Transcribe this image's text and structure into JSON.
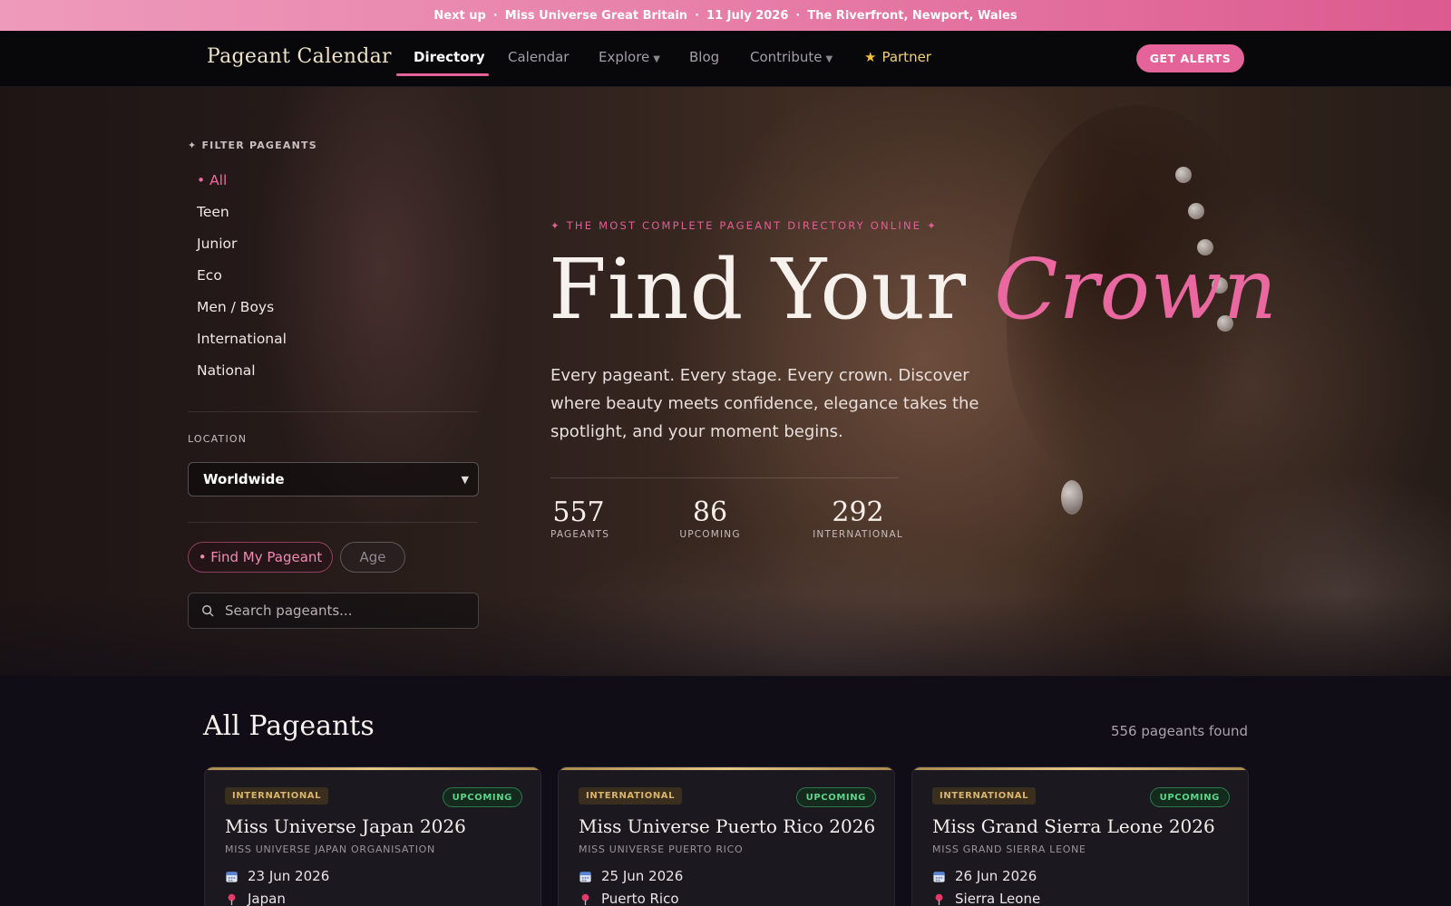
{
  "announcement": {
    "prefix": "Next up",
    "event": "Miss Universe Great Britain",
    "date": "11 July 2026",
    "venue": "The Riverfront, Newport, Wales"
  },
  "nav": {
    "brand": "Pageant Calendar",
    "links": [
      {
        "label": "Directory",
        "active": true
      },
      {
        "label": "Calendar"
      },
      {
        "label": "Explore",
        "has_dropdown": true
      },
      {
        "label": "Blog"
      },
      {
        "label": "Contribute",
        "has_dropdown": true
      },
      {
        "label": "Partner",
        "icon": "star-icon"
      }
    ],
    "cta": "GET ALERTS"
  },
  "sidebar": {
    "filter_title": "✦ FILTER PAGEANTS",
    "filters": [
      {
        "label": "• All",
        "active": true
      },
      {
        "label": "Teen"
      },
      {
        "label": "Junior"
      },
      {
        "label": "Eco"
      },
      {
        "label": "Men / Boys"
      },
      {
        "label": "International"
      },
      {
        "label": "National"
      }
    ],
    "location_label": "LOCATION",
    "location_value": "Worldwide",
    "find_label": "• Find My Pageant",
    "age_label": "Age",
    "search_placeholder": "Search pageants..."
  },
  "hero": {
    "eyebrow": "✦ THE MOST COMPLETE PAGEANT DIRECTORY ONLINE ✦",
    "headline_plain": "Find Your ",
    "headline_accent": "Crown",
    "subcopy": "Every pageant. Every stage. Every crown. Discover where beauty meets confidence, elegance takes the spotlight, and your moment begins.",
    "stats": [
      {
        "value": "557",
        "label": "PAGEANTS"
      },
      {
        "value": "86",
        "label": "UPCOMING"
      },
      {
        "value": "292",
        "label": "INTERNATIONAL"
      }
    ]
  },
  "listing": {
    "title": "All Pageants",
    "count_text": "556 pageants found",
    "cards": [
      {
        "category": "INTERNATIONAL",
        "status": "UPCOMING",
        "title": "Miss Universe Japan 2026",
        "org": "MISS UNIVERSE JAPAN ORGANISATION",
        "date": "23 Jun 2026",
        "location": "Japan"
      },
      {
        "category": "INTERNATIONAL",
        "status": "UPCOMING",
        "title": "Miss Universe Puerto Rico 2026",
        "org": "MISS UNIVERSE PUERTO RICO",
        "date": "25 Jun 2026",
        "location": "Puerto Rico"
      },
      {
        "category": "INTERNATIONAL",
        "status": "UPCOMING",
        "title": "Miss Grand Sierra Leone 2026",
        "org": "MISS GRAND SIERRA LEONE",
        "date": "26 Jun 2026",
        "location": "Sierra Leone"
      }
    ]
  },
  "colors": {
    "accent_pink": "#e4649a",
    "gold": "#d9b46c",
    "upcoming_green": "#5fd48a",
    "background": "#100d16"
  }
}
